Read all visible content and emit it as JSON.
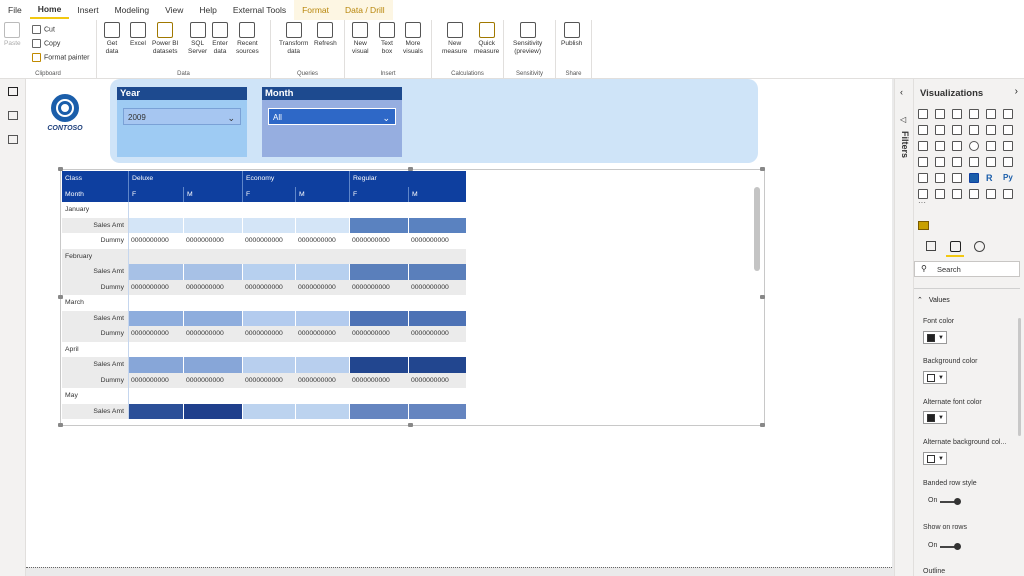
{
  "ribbon": {
    "tabs": [
      {
        "label": "File"
      },
      {
        "label": "Home"
      },
      {
        "label": "Insert"
      },
      {
        "label": "Modeling"
      },
      {
        "label": "View"
      },
      {
        "label": "Help"
      },
      {
        "label": "External Tools"
      },
      {
        "label": "Format"
      },
      {
        "label": "Data / Drill"
      }
    ],
    "clipboard": {
      "paste": "Paste",
      "cut": "Cut",
      "copy": "Copy",
      "format_painter": "Format painter",
      "group": "Clipboard"
    },
    "data": {
      "get_data": "Get\ndata",
      "excel": "Excel",
      "pbi": "Power BI\ndatasets",
      "sql": "SQL\nServer",
      "enter": "Enter\ndata",
      "recent": "Recent\nsources",
      "group": "Data"
    },
    "queries": {
      "transform": "Transform\ndata",
      "refresh": "Refresh",
      "group": "Queries"
    },
    "insert": {
      "new_visual": "New\nvisual",
      "text_box": "Text\nbox",
      "more_visuals": "More\nvisuals",
      "group": "Insert"
    },
    "calculations": {
      "new_measure": "New\nmeasure",
      "quick_measure": "Quick\nmeasure",
      "group": "Calculations"
    },
    "sensitivity": {
      "label": "Sensitivity\n(preview)",
      "group": "Sensitivity"
    },
    "share": {
      "publish": "Publish",
      "group": "Share"
    }
  },
  "logo": {
    "text": "CONTOSO",
    "color": "#1b5eaa"
  },
  "slicers": {
    "year": {
      "title": "Year",
      "value": "2009"
    },
    "month": {
      "title": "Month",
      "value": "All"
    }
  },
  "matrix": {
    "header1": [
      "Class",
      "Deluxe",
      "",
      "Economy",
      "",
      "Regular",
      ""
    ],
    "header2": [
      "Month",
      "F",
      "M",
      "F",
      "M",
      "F",
      "M"
    ],
    "rows": [
      {
        "kind": "month",
        "label": "January"
      },
      {
        "kind": "sales",
        "label": "Sales Amt",
        "colors": [
          "#d4e5f7",
          "#d4e5f7",
          "#d4e5f7",
          "#d4e5f7",
          "#5a82c0",
          "#5a82c0"
        ]
      },
      {
        "kind": "dummy",
        "label": "Dummy",
        "values": [
          "0000000000",
          "0000000000",
          "0000000000",
          "0000000000",
          "0000000000",
          "0000000000"
        ]
      },
      {
        "kind": "month",
        "label": "February"
      },
      {
        "kind": "sales",
        "label": "Sales Amt",
        "colors": [
          "#a7c1e6",
          "#a7c1e6",
          "#b7d0ef",
          "#b7d0ef",
          "#5a7fbb",
          "#5a7fbb"
        ]
      },
      {
        "kind": "dummy",
        "label": "Dummy",
        "values": [
          "0000000000",
          "0000000000",
          "0000000000",
          "0000000000",
          "0000000000",
          "0000000000"
        ]
      },
      {
        "kind": "month",
        "label": "March"
      },
      {
        "kind": "sales",
        "label": "Sales Amt",
        "colors": [
          "#8eaddd",
          "#8eaddd",
          "#b3cbee",
          "#b3cbee",
          "#4d72b5",
          "#4d72b5"
        ]
      },
      {
        "kind": "dummy",
        "label": "Dummy",
        "values": [
          "0000000000",
          "0000000000",
          "0000000000",
          "0000000000",
          "0000000000",
          "0000000000"
        ]
      },
      {
        "kind": "month",
        "label": "April"
      },
      {
        "kind": "sales",
        "label": "Sales Amt",
        "colors": [
          "#87a6d8",
          "#87a6d8",
          "#b8cfee",
          "#b8cfee",
          "#22468f",
          "#22468f"
        ]
      },
      {
        "kind": "dummy",
        "label": "Dummy",
        "values": [
          "0000000000",
          "0000000000",
          "0000000000",
          "0000000000",
          "0000000000",
          "0000000000"
        ]
      },
      {
        "kind": "month",
        "label": "May"
      },
      {
        "kind": "sales",
        "label": "Sales Amt",
        "colors": [
          "#2b4f98",
          "#1f3f8c",
          "#bcd3ef",
          "#bcd3ef",
          "#6585c0",
          "#6585c0"
        ]
      }
    ]
  },
  "filters": {
    "label": "Filters"
  },
  "visualizations": {
    "title": "Visualizations",
    "more": "···",
    "search_placeholder": "Search",
    "section": "Values",
    "font_color": "Font color",
    "background_color": "Background color",
    "alt_font_color": "Alternate font color",
    "alt_bg_color": "Alternate background col...",
    "banded_row_style": "Banded row style",
    "banded_on": "On",
    "show_on_rows": "Show on rows",
    "show_on": "On",
    "outline": "Outline",
    "r_label": "R",
    "py_label": "Py"
  }
}
